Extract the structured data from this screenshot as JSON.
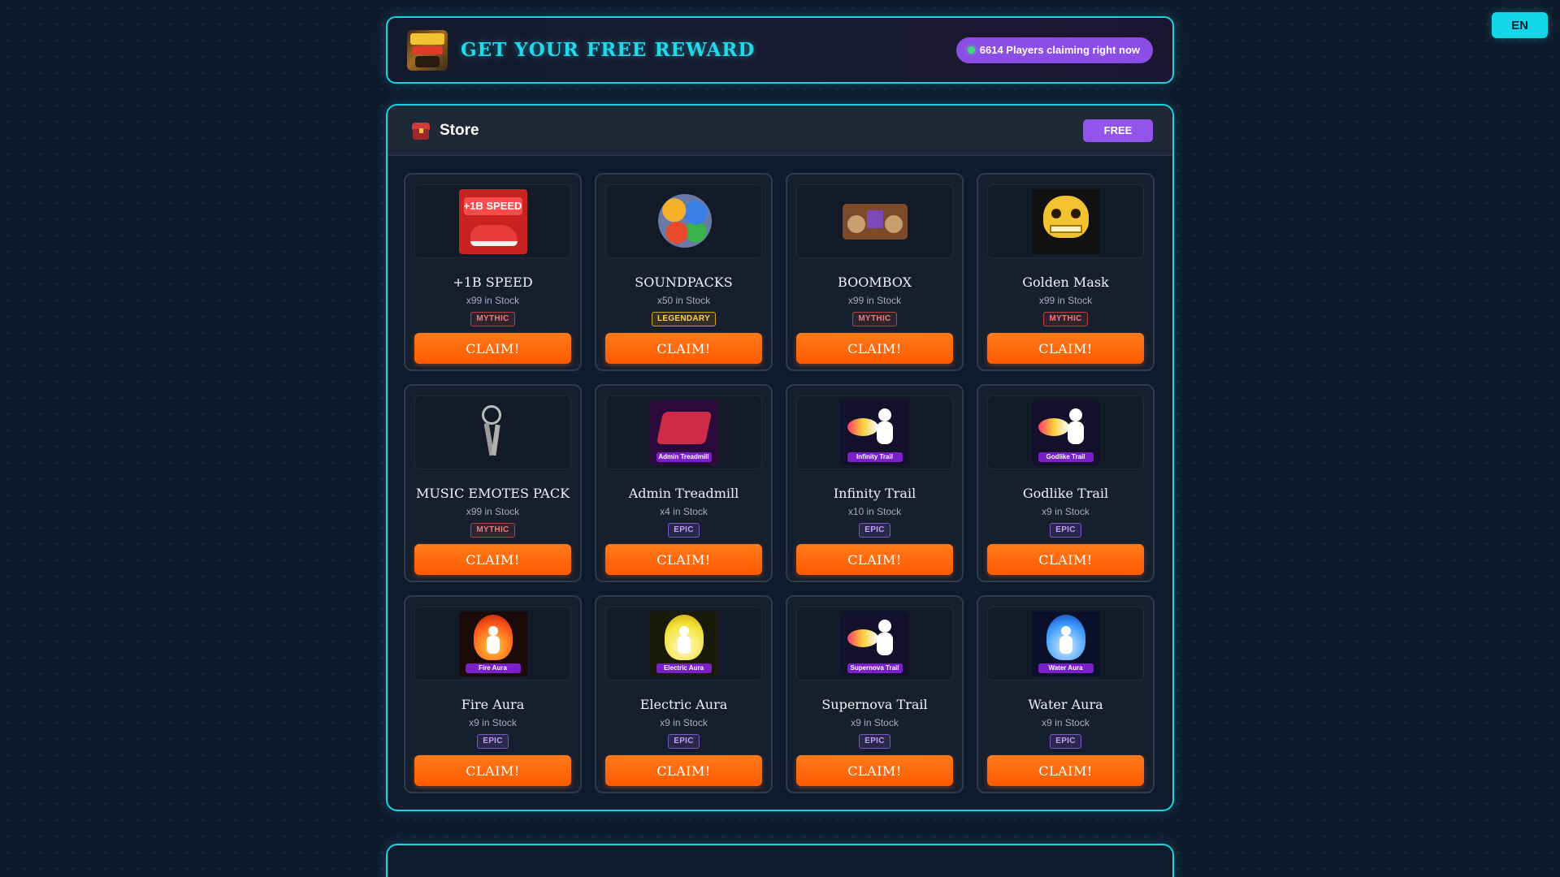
{
  "language_button": "EN",
  "header": {
    "title": "GET YOUR FREE REWARD",
    "live_count": "6614 Players claiming right now",
    "logo_icon": "speed-keyboard-escape-logo"
  },
  "store": {
    "title": "Store",
    "badge": "FREE",
    "claim_label": "CLAIM!",
    "items": [
      {
        "name": "+1B SPEED",
        "stock": "x99 in Stock",
        "rarity": "MYTHIC",
        "icon": "red-sneaker-icon"
      },
      {
        "name": "SOUNDPACKS",
        "stock": "x50 in Stock",
        "rarity": "LEGENDARY",
        "icon": "sound-orbs-icon"
      },
      {
        "name": "BOOMBOX",
        "stock": "x99 in Stock",
        "rarity": "MYTHIC",
        "icon": "boombox-icon"
      },
      {
        "name": "Golden Mask",
        "stock": "x99 in Stock",
        "rarity": "MYTHIC",
        "icon": "golden-skull-mask-icon"
      },
      {
        "name": "MUSIC EMOTES PACK",
        "stock": "x99 in Stock",
        "rarity": "MYTHIC",
        "icon": "keyring-icon"
      },
      {
        "name": "Admin Treadmill",
        "stock": "x4 in Stock",
        "rarity": "EPIC",
        "icon": "treadmill-icon",
        "thumb_label": "Admin Treadmill"
      },
      {
        "name": "Infinity Trail",
        "stock": "x10 in Stock",
        "rarity": "EPIC",
        "icon": "trail-icon",
        "thumb_label": "Infinity Trail"
      },
      {
        "name": "Godlike Trail",
        "stock": "x9 in Stock",
        "rarity": "EPIC",
        "icon": "trail-icon",
        "thumb_label": "Godlike Trail"
      },
      {
        "name": "Fire Aura",
        "stock": "x9 in Stock",
        "rarity": "EPIC",
        "icon": "fire-aura-icon",
        "thumb_label": "Fire Aura"
      },
      {
        "name": "Electric Aura",
        "stock": "x9 in Stock",
        "rarity": "EPIC",
        "icon": "electric-aura-icon",
        "thumb_label": "Electric Aura"
      },
      {
        "name": "Supernova Trail",
        "stock": "x9 in Stock",
        "rarity": "EPIC",
        "icon": "trail-icon",
        "thumb_label": "Supernova Trail"
      },
      {
        "name": "Water Aura",
        "stock": "x9 in Stock",
        "rarity": "EPIC",
        "icon": "water-aura-icon",
        "thumb_label": "Water Aura"
      }
    ]
  },
  "colors": {
    "accent_cyan": "#19d3e2",
    "claim_orange": "#ff6a0a",
    "live_purple": "#8c4ce6",
    "mythic": "#f17878",
    "legendary": "#ffd24a",
    "epic": "#c59cff"
  }
}
